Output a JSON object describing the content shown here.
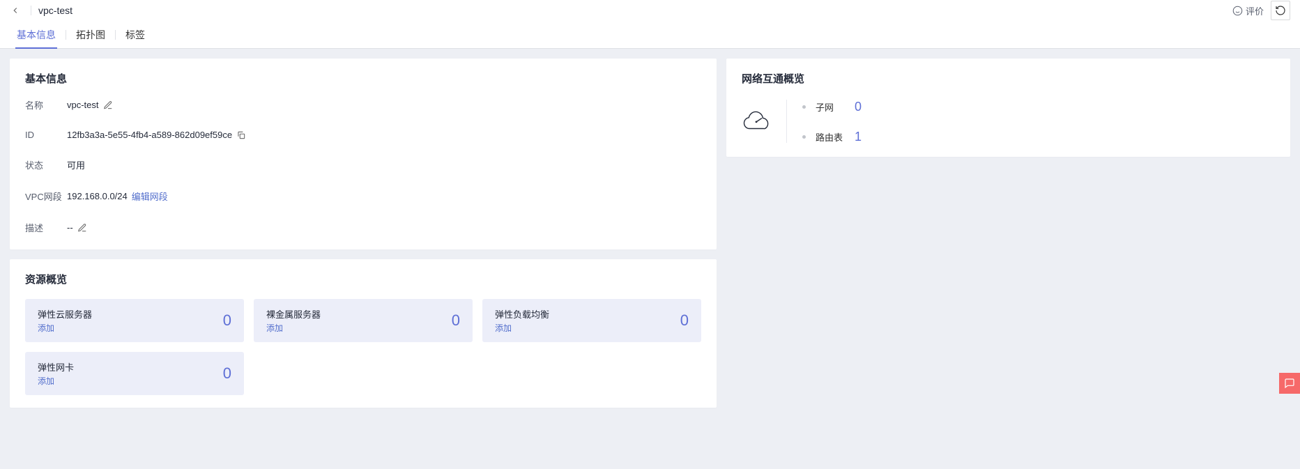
{
  "header": {
    "title": "vpc-test",
    "feedback_label": "评价"
  },
  "tabs": [
    {
      "label": "基本信息",
      "active": true
    },
    {
      "label": "拓扑图",
      "active": false
    },
    {
      "label": "标签",
      "active": false
    }
  ],
  "basic_info": {
    "title": "基本信息",
    "rows": {
      "name": {
        "label": "名称",
        "value": "vpc-test"
      },
      "id": {
        "label": "ID",
        "value": "12fb3a3a-5e55-4fb4-a589-862d09ef59ce"
      },
      "status": {
        "label": "状态",
        "value": "可用"
      },
      "cidr": {
        "label": "VPC网段",
        "value": "192.168.0.0/24",
        "edit_link": "编辑网段"
      },
      "desc": {
        "label": "描述",
        "value": "--"
      }
    }
  },
  "resource_overview": {
    "title": "资源概览",
    "add_label": "添加",
    "items": [
      {
        "name": "弹性云服务器",
        "count": 0
      },
      {
        "name": "裸金属服务器",
        "count": 0
      },
      {
        "name": "弹性负载均衡",
        "count": 0
      },
      {
        "name": "弹性网卡",
        "count": 0
      }
    ]
  },
  "network_overview": {
    "title": "网络互通概览",
    "items": [
      {
        "label": "子网",
        "value": 0
      },
      {
        "label": "路由表",
        "value": 1
      }
    ]
  }
}
